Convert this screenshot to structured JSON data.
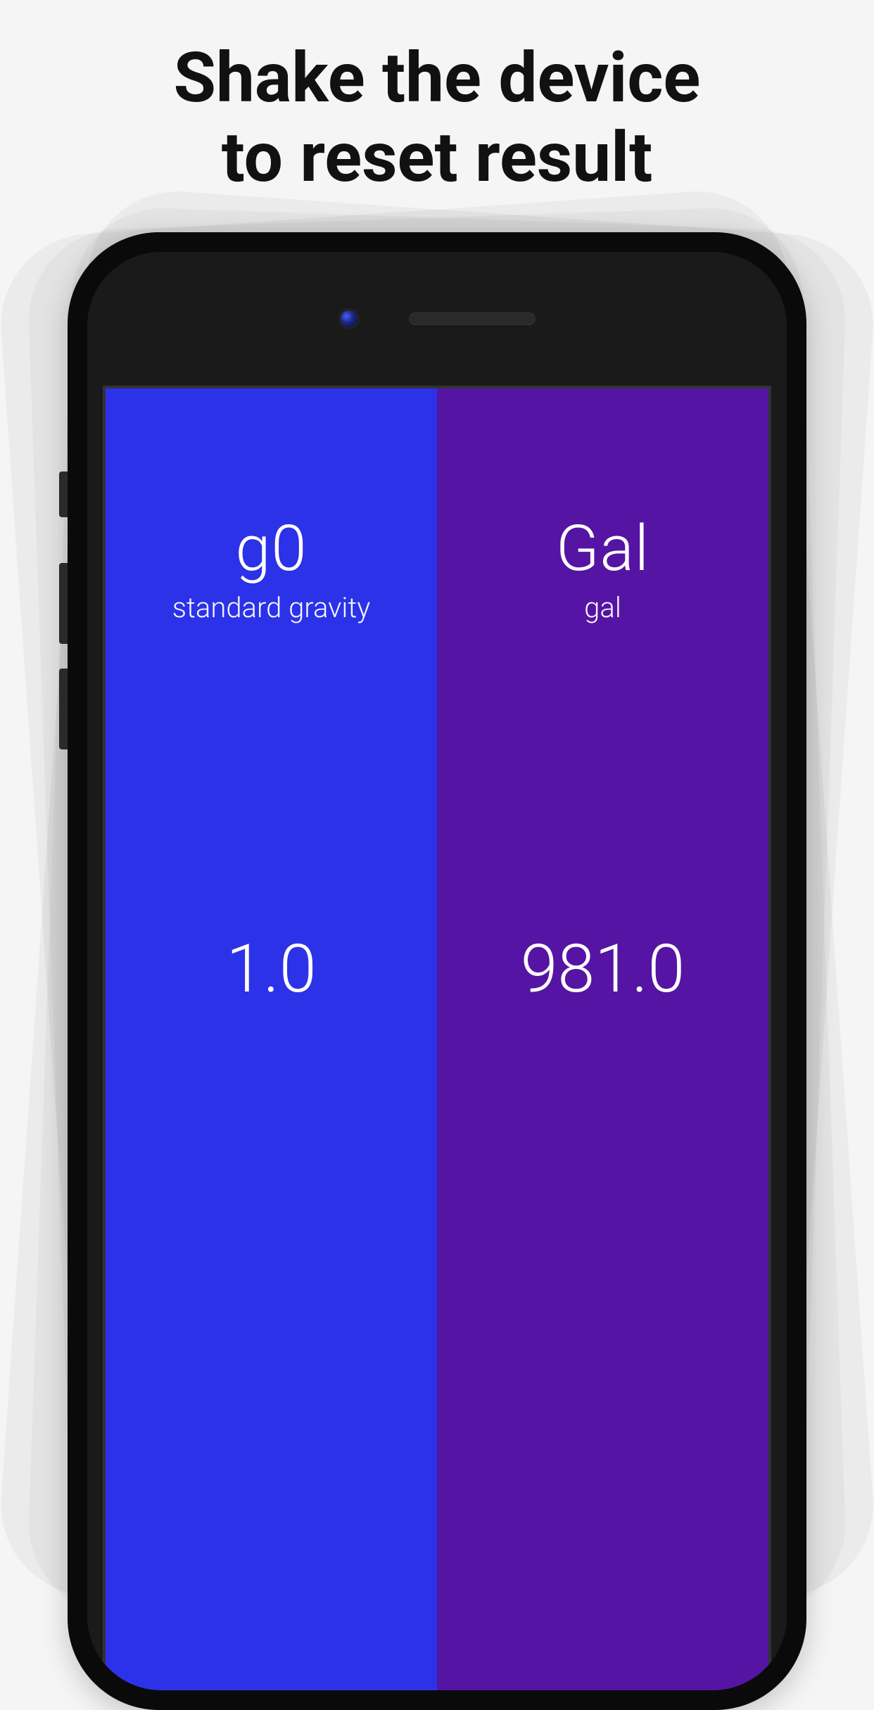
{
  "headline": {
    "line1": "Shake the device",
    "line2": "to reset result"
  },
  "converter": {
    "left": {
      "symbol": "g0",
      "name": "standard gravity",
      "value": "1.0",
      "bg_color": "#2c32e8"
    },
    "right": {
      "symbol": "Gal",
      "name": "gal",
      "value": "981.0",
      "bg_color": "#5514a3"
    }
  }
}
